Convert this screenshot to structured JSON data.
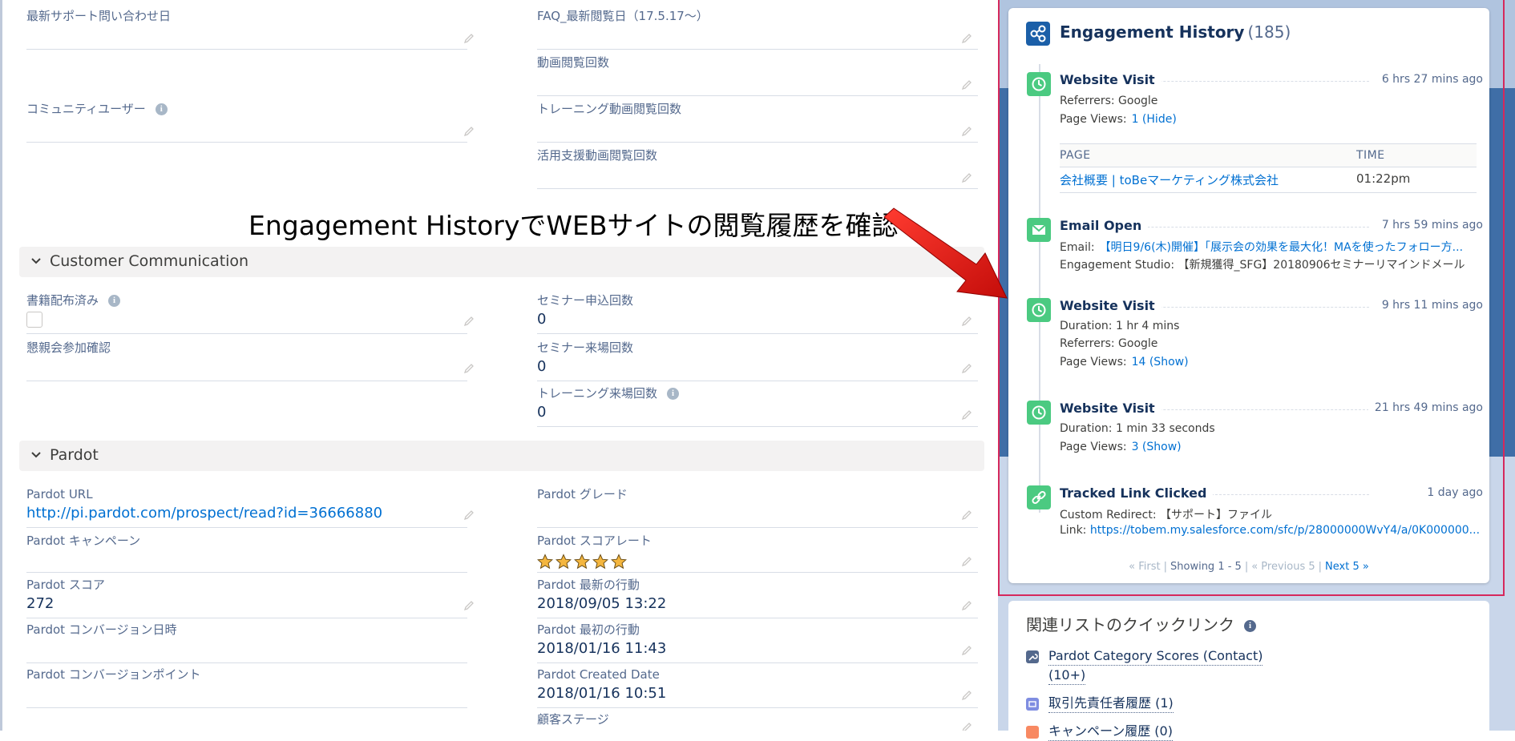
{
  "left": {
    "fields": [
      {
        "id": "f1",
        "label": "最新サポート問い合わせ日",
        "value": ""
      },
      {
        "id": "f2",
        "label": "FAQ_最新閲覧日（17.5.17～）",
        "value": ""
      },
      {
        "id": "f3",
        "label": "動画閲覧回数",
        "value": ""
      },
      {
        "id": "f4",
        "label": "コミュニティユーザー",
        "value": ""
      },
      {
        "id": "f5",
        "label": "トレーニング動画閲覧回数",
        "value": ""
      },
      {
        "id": "f6",
        "label": "活用支援動画閲覧回数",
        "value": ""
      },
      {
        "id": "f7",
        "label": "書籍配布済み",
        "value": ""
      },
      {
        "id": "f8",
        "label": "セミナー申込回数",
        "value": "0"
      },
      {
        "id": "f9",
        "label": "懇親会参加確認",
        "value": ""
      },
      {
        "id": "f10",
        "label": "セミナー来場回数",
        "value": "0"
      },
      {
        "id": "f11",
        "label": "トレーニング来場回数",
        "value": "0"
      },
      {
        "id": "f12",
        "label": "Pardot URL",
        "value": "http://pi.pardot.com/prospect/read?id=36666880"
      },
      {
        "id": "f13",
        "label": "Pardot グレード",
        "value": ""
      },
      {
        "id": "f14",
        "label": "Pardot キャンペーン",
        "value": ""
      },
      {
        "id": "f15",
        "label": "Pardot スコアレート",
        "value": ""
      },
      {
        "id": "f16",
        "label": "Pardot スコア",
        "value": "272"
      },
      {
        "id": "f17",
        "label": "Pardot 最新の行動",
        "value": "2018/09/05 13:22"
      },
      {
        "id": "f18",
        "label": "Pardot コンバージョン日時",
        "value": ""
      },
      {
        "id": "f19",
        "label": "Pardot 最初の行動",
        "value": "2018/01/16 11:43"
      },
      {
        "id": "f20",
        "label": "Pardot コンバージョンポイント",
        "value": ""
      },
      {
        "id": "f21",
        "label": "Pardot Created Date",
        "value": "2018/01/16 10:51"
      },
      {
        "id": "f22",
        "label": "顧客ステージ",
        "value": ""
      }
    ],
    "score_rating_stars": 5,
    "sections": {
      "customer_communication": "Customer Communication",
      "pardot": "Pardot"
    },
    "callout": "Engagement HistoryでWEBサイトの閲覧履歴を確認"
  },
  "engagement": {
    "title": "Engagement History",
    "count": "(185)",
    "events": [
      {
        "title": "Website Visit",
        "time": "6 hrs 27 mins ago",
        "referrers_label": "Referrers:",
        "referrers": "Google",
        "page_views_label": "Page Views:",
        "page_views_link": "1 (Hide)"
      },
      {
        "title": "Email Open",
        "time": "7 hrs 59 mins ago",
        "email_label": "Email:",
        "email_link": "【明日9/6(木)開催】「展示会の効果を最大化！MAを使ったフォロー方...",
        "studio_line": "Engagement Studio: 【新規獲得_SFG】20180906セミナーリマインドメール"
      },
      {
        "title": "Website Visit",
        "time": "9 hrs 11 mins ago",
        "duration": "Duration: 1 hr 4 mins",
        "referrers_label": "Referrers:",
        "referrers": "Google",
        "page_views_label": "Page Views:",
        "page_views_link": "14 (Show)"
      },
      {
        "title": "Website Visit",
        "time": "21 hrs 49 mins ago",
        "duration": "Duration: 1 min 33 seconds",
        "page_views_label": "Page Views:",
        "page_views_link": "3 (Show)"
      },
      {
        "title": "Tracked Link Clicked",
        "time": "1 day ago",
        "custom_redirect": "Custom Redirect: 【サポート】ファイル",
        "link_label": "Link:",
        "link_url": "https://tobem.my.salesforce.com/sfc/p/28000000WvY4/a/0K000000..."
      }
    ],
    "page_table": {
      "col_page": "PAGE",
      "col_time": "TIME",
      "row_page": "会社概要 | toBeマーケティング株式会社",
      "row_time": "01:22pm"
    },
    "pager": {
      "first": "« First",
      "showing": "Showing",
      "range": "1 - 5",
      "previous": "« Previous 5",
      "next": "Next 5 »",
      "sep": "|"
    }
  },
  "quick_links": {
    "title": "関連リストのクイックリンク",
    "items": [
      {
        "label": "Pardot Category Scores (Contact)",
        "sub": "(10+)",
        "color": "#54698d"
      },
      {
        "label": "取引先責任者履歴 (1)",
        "color": "#7f8de1"
      },
      {
        "label": "キャンペーン履歴 (0)",
        "color": "#f88962"
      }
    ]
  },
  "colors": {
    "accent": "#0070d2",
    "event_green": "#4bca81",
    "highlight": "#d6285c",
    "arrow": "#e5140f"
  }
}
